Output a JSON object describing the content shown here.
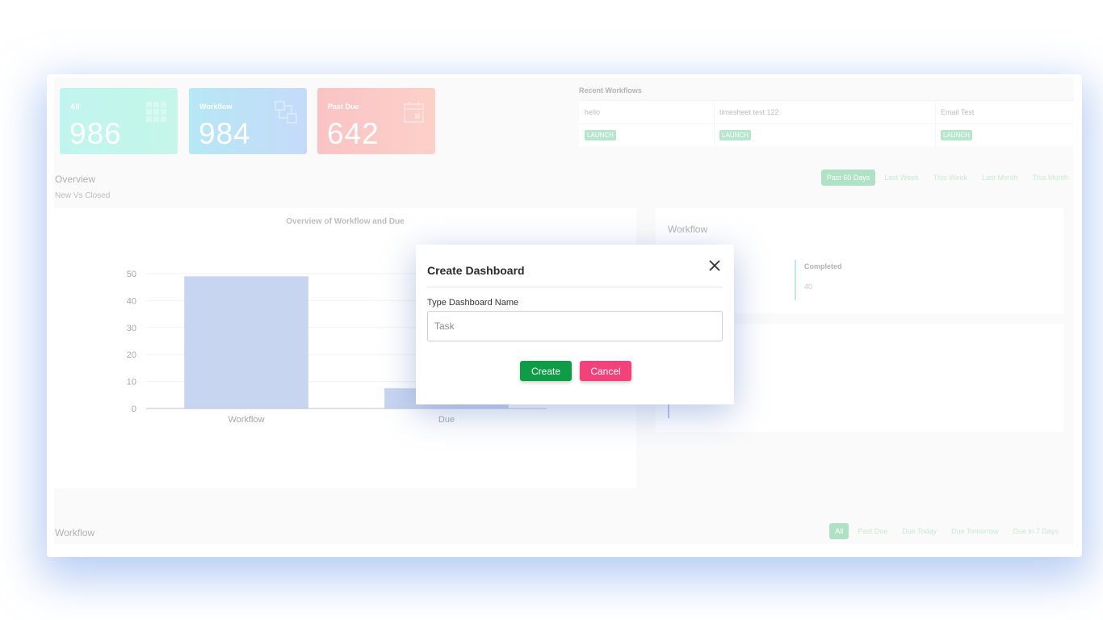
{
  "cards": [
    {
      "label": "All",
      "value": "986",
      "icon": "grid-icon"
    },
    {
      "label": "Workflow",
      "value": "984",
      "icon": "workflow-icon"
    },
    {
      "label": "Past Due",
      "value": "642",
      "icon": "calendar-icon"
    }
  ],
  "recent": {
    "title": "Recent Workflows",
    "items": [
      {
        "name": "hello",
        "action": "LAUNCH"
      },
      {
        "name": "timesheet test 122",
        "action": "LAUNCH"
      },
      {
        "name": "Email Test",
        "action": "LAUNCH"
      }
    ]
  },
  "overview": {
    "title": "Overview",
    "subtitle": "New Vs Closed",
    "filters": [
      "Past 60 Days",
      "Last Week",
      "This Week",
      "Last Month",
      "This Month"
    ],
    "active_filter": "Past 60 Days"
  },
  "chart_data": {
    "type": "bar",
    "title": "Overview of Workflow and Due",
    "categories": [
      "Workflow",
      "Due"
    ],
    "values": [
      49,
      7.5
    ],
    "ylim": [
      0,
      50
    ],
    "yticks": [
      0,
      10,
      20,
      30,
      40,
      50
    ],
    "grid": true,
    "color": "#aabfe8"
  },
  "workflow_panel": {
    "title": "Workflow",
    "completed_label": "Completed",
    "completed_value": "40"
  },
  "workflow_section": {
    "title": "Workflow",
    "filters": [
      "All",
      "Past Due",
      "Due Today",
      "Due Tomorrow",
      "Due in 7 Days"
    ],
    "active_filter": "All"
  },
  "modal": {
    "title": "Create Dashboard",
    "field_label": "Type Dashboard Name",
    "placeholder": "Task",
    "create_label": "Create",
    "cancel_label": "Cancel"
  }
}
